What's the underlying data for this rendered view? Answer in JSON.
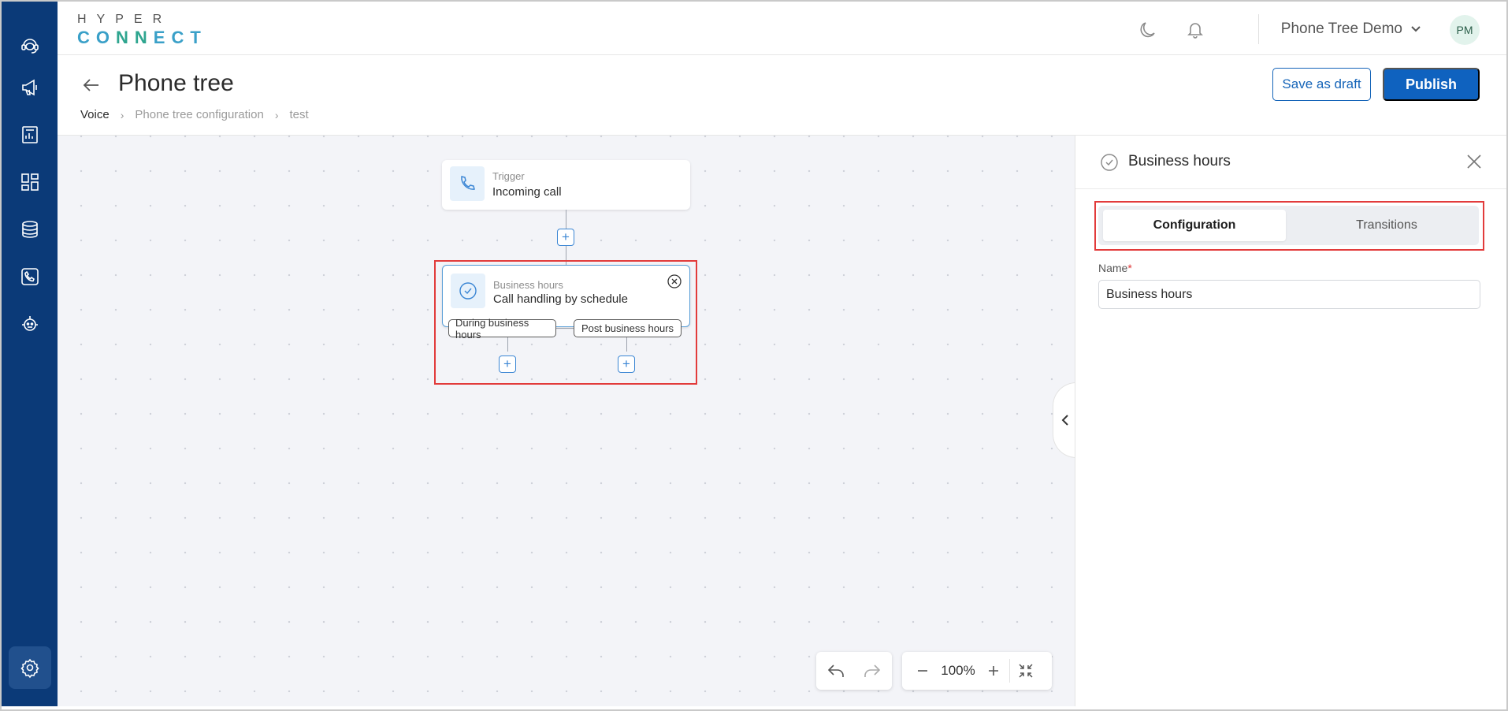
{
  "brand": {
    "line1": "HYPER",
    "line2_a": "CO",
    "line2_n": "NN",
    "line2_b": "ECT"
  },
  "sidebar": {
    "items": [
      {
        "icon": "headset-icon"
      },
      {
        "icon": "megaphone-icon"
      },
      {
        "icon": "report-icon"
      },
      {
        "icon": "dashboard-icon"
      },
      {
        "icon": "database-icon"
      },
      {
        "icon": "phone-icon"
      },
      {
        "icon": "bot-icon"
      }
    ],
    "bottom_item": {
      "icon": "settings-icon",
      "active": true
    }
  },
  "header": {
    "account_name": "Phone Tree Demo",
    "avatar_initials": "PM",
    "icons": [
      "moon-icon",
      "bell-icon"
    ]
  },
  "page": {
    "title": "Phone tree",
    "breadcrumb": [
      "Voice",
      "Phone tree configuration",
      "test"
    ],
    "save_draft_label": "Save as draft",
    "publish_label": "Publish"
  },
  "canvas": {
    "trigger_node": {
      "small": "Trigger",
      "main": "Incoming call"
    },
    "hours_node": {
      "small": "Business hours",
      "main": "Call handling by schedule"
    },
    "branches": [
      "During business hours",
      "Post business hours"
    ],
    "zoom": "100%"
  },
  "panel": {
    "title": "Business hours",
    "tabs": [
      "Configuration",
      "Transitions"
    ],
    "active_tab": "Configuration",
    "name_label": "Name",
    "required_mark": "*",
    "name_value": "Business hours"
  },
  "colors": {
    "sidebar": "#0b3a78",
    "primary": "#0f62bf",
    "highlight": "#e23b3b",
    "canvas_bg": "#f3f4f8"
  }
}
